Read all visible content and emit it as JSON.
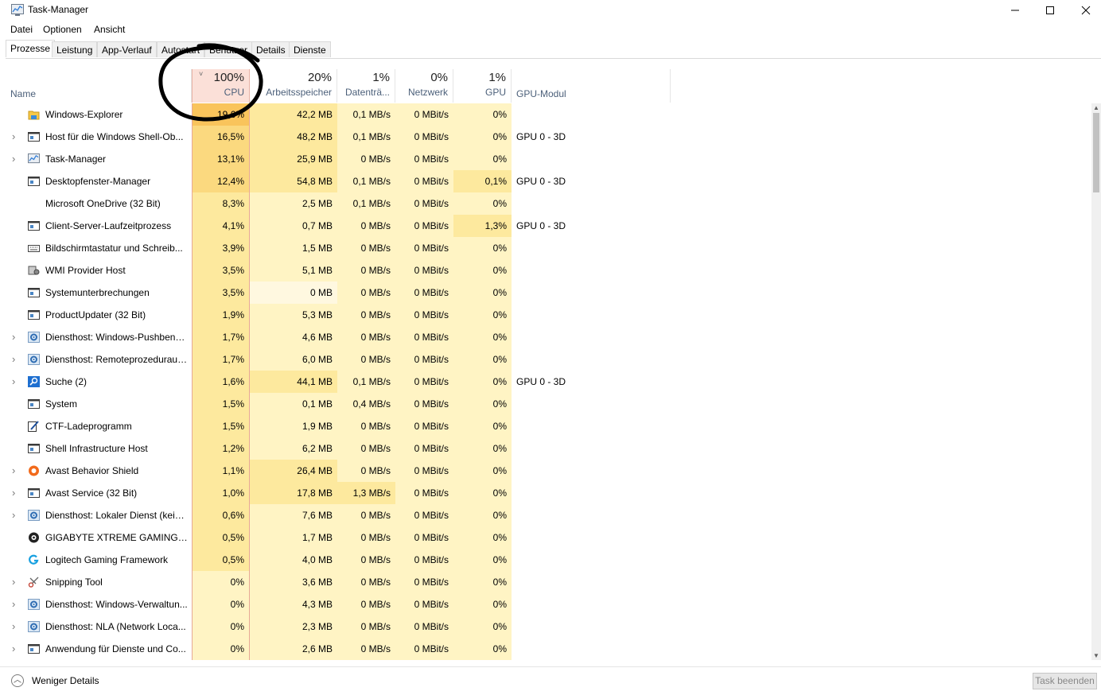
{
  "window": {
    "title": "Task-Manager",
    "icon": "task-manager-icon"
  },
  "window_controls": {
    "minimize": "—",
    "maximize": "☐",
    "close": "✕"
  },
  "menu": [
    "Datei",
    "Optionen",
    "Ansicht"
  ],
  "tabs": [
    "Prozesse",
    "Leistung",
    "App-Verlauf",
    "Autostart",
    "Benutzer",
    "Details",
    "Dienste"
  ],
  "active_tab": "Prozesse",
  "columns": {
    "name": "Name",
    "cpu": {
      "pct": "100%",
      "label": "CPU"
    },
    "memory": {
      "pct": "20%",
      "label": "Arbeitsspeicher"
    },
    "disk": {
      "pct": "1%",
      "label": "Datenträ..."
    },
    "network": {
      "pct": "0%",
      "label": "Netzwerk"
    },
    "gpu": {
      "pct": "1%",
      "label": "GPU"
    },
    "gpu_engine": {
      "label": "GPU-Modul"
    }
  },
  "sort_indicator": "˅",
  "processes": [
    {
      "name": "Windows-Explorer",
      "expand": false,
      "icon": "folder-icon",
      "cpu": "19,6%",
      "mem": "42,2 MB",
      "disk": "0,1 MB/s",
      "net": "0 MBit/s",
      "gpu": "0%",
      "engine": "",
      "cpu_level": 4,
      "mem_level": 2,
      "disk_level": 1,
      "gpu_level": 1
    },
    {
      "name": "Host für die Windows Shell-Ob...",
      "expand": true,
      "icon": "window-app-icon",
      "cpu": "16,5%",
      "mem": "48,2 MB",
      "disk": "0,1 MB/s",
      "net": "0 MBit/s",
      "gpu": "0%",
      "engine": "GPU 0 - 3D",
      "cpu_level": 3,
      "mem_level": 2,
      "disk_level": 1,
      "gpu_level": 1
    },
    {
      "name": "Task-Manager",
      "expand": true,
      "icon": "task-manager-icon",
      "cpu": "13,1%",
      "mem": "25,9 MB",
      "disk": "0 MB/s",
      "net": "0 MBit/s",
      "gpu": "0%",
      "engine": "",
      "cpu_level": 3,
      "mem_level": 2,
      "disk_level": 1,
      "gpu_level": 1
    },
    {
      "name": "Desktopfenster-Manager",
      "expand": false,
      "icon": "window-app-icon",
      "cpu": "12,4%",
      "mem": "54,8 MB",
      "disk": "0,1 MB/s",
      "net": "0 MBit/s",
      "gpu": "0,1%",
      "engine": "GPU 0 - 3D",
      "cpu_level": 3,
      "mem_level": 2,
      "disk_level": 1,
      "gpu_level": 2
    },
    {
      "name": "Microsoft OneDrive (32 Bit)",
      "expand": false,
      "icon": "blank-icon",
      "cpu": "8,3%",
      "mem": "2,5 MB",
      "disk": "0,1 MB/s",
      "net": "0 MBit/s",
      "gpu": "0%",
      "engine": "",
      "cpu_level": 2,
      "mem_level": 1,
      "disk_level": 1,
      "gpu_level": 1
    },
    {
      "name": "Client-Server-Laufzeitprozess",
      "expand": false,
      "icon": "window-app-icon",
      "cpu": "4,1%",
      "mem": "0,7 MB",
      "disk": "0 MB/s",
      "net": "0 MBit/s",
      "gpu": "1,3%",
      "engine": "GPU 0 - 3D",
      "cpu_level": 2,
      "mem_level": 1,
      "disk_level": 1,
      "gpu_level": 2
    },
    {
      "name": "Bildschirmtastatur und Schreib...",
      "expand": false,
      "icon": "keyboard-icon",
      "cpu": "3,9%",
      "mem": "1,5 MB",
      "disk": "0 MB/s",
      "net": "0 MBit/s",
      "gpu": "0%",
      "engine": "",
      "cpu_level": 2,
      "mem_level": 1,
      "disk_level": 1,
      "gpu_level": 1
    },
    {
      "name": "WMI Provider Host",
      "expand": false,
      "icon": "wmi-icon",
      "cpu": "3,5%",
      "mem": "5,1 MB",
      "disk": "0 MB/s",
      "net": "0 MBit/s",
      "gpu": "0%",
      "engine": "",
      "cpu_level": 2,
      "mem_level": 1,
      "disk_level": 1,
      "gpu_level": 1
    },
    {
      "name": "Systemunterbrechungen",
      "expand": false,
      "icon": "window-app-icon",
      "cpu": "3,5%",
      "mem": "0 MB",
      "disk": "0 MB/s",
      "net": "0 MBit/s",
      "gpu": "0%",
      "engine": "",
      "cpu_level": 2,
      "mem_level": 0,
      "disk_level": 1,
      "gpu_level": 1
    },
    {
      "name": "ProductUpdater (32 Bit)",
      "expand": false,
      "icon": "window-app-icon",
      "cpu": "1,9%",
      "mem": "5,3 MB",
      "disk": "0 MB/s",
      "net": "0 MBit/s",
      "gpu": "0%",
      "engine": "",
      "cpu_level": 2,
      "mem_level": 1,
      "disk_level": 1,
      "gpu_level": 1
    },
    {
      "name": "Diensthost: Windows-Pushbena...",
      "expand": true,
      "icon": "gear-icon",
      "cpu": "1,7%",
      "mem": "4,6 MB",
      "disk": "0 MB/s",
      "net": "0 MBit/s",
      "gpu": "0%",
      "engine": "",
      "cpu_level": 2,
      "mem_level": 1,
      "disk_level": 1,
      "gpu_level": 1
    },
    {
      "name": "Diensthost: Remoteprozeduraufr...",
      "expand": true,
      "icon": "gear-icon",
      "cpu": "1,7%",
      "mem": "6,0 MB",
      "disk": "0 MB/s",
      "net": "0 MBit/s",
      "gpu": "0%",
      "engine": "",
      "cpu_level": 2,
      "mem_level": 1,
      "disk_level": 1,
      "gpu_level": 1
    },
    {
      "name": "Suche (2)",
      "expand": true,
      "icon": "search-icon",
      "cpu": "1,6%",
      "mem": "44,1 MB",
      "disk": "0,1 MB/s",
      "net": "0 MBit/s",
      "gpu": "0%",
      "engine": "GPU 0 - 3D",
      "cpu_level": 2,
      "mem_level": 2,
      "disk_level": 1,
      "gpu_level": 1
    },
    {
      "name": "System",
      "expand": false,
      "icon": "window-app-icon",
      "cpu": "1,5%",
      "mem": "0,1 MB",
      "disk": "0,4 MB/s",
      "net": "0 MBit/s",
      "gpu": "0%",
      "engine": "",
      "cpu_level": 2,
      "mem_level": 1,
      "disk_level": 1,
      "gpu_level": 1
    },
    {
      "name": "CTF-Ladeprogramm",
      "expand": false,
      "icon": "pen-icon",
      "cpu": "1,5%",
      "mem": "1,9 MB",
      "disk": "0 MB/s",
      "net": "0 MBit/s",
      "gpu": "0%",
      "engine": "",
      "cpu_level": 2,
      "mem_level": 1,
      "disk_level": 1,
      "gpu_level": 1
    },
    {
      "name": "Shell Infrastructure Host",
      "expand": false,
      "icon": "window-app-icon",
      "cpu": "1,2%",
      "mem": "6,2 MB",
      "disk": "0 MB/s",
      "net": "0 MBit/s",
      "gpu": "0%",
      "engine": "",
      "cpu_level": 2,
      "mem_level": 1,
      "disk_level": 1,
      "gpu_level": 1
    },
    {
      "name": "Avast Behavior Shield",
      "expand": true,
      "icon": "avast-icon",
      "cpu": "1,1%",
      "mem": "26,4 MB",
      "disk": "0 MB/s",
      "net": "0 MBit/s",
      "gpu": "0%",
      "engine": "",
      "cpu_level": 2,
      "mem_level": 2,
      "disk_level": 1,
      "gpu_level": 1
    },
    {
      "name": "Avast Service (32 Bit)",
      "expand": true,
      "icon": "window-app-icon",
      "cpu": "1,0%",
      "mem": "17,8 MB",
      "disk": "1,3 MB/s",
      "net": "0 MBit/s",
      "gpu": "0%",
      "engine": "",
      "cpu_level": 2,
      "mem_level": 2,
      "disk_level": 2,
      "gpu_level": 1
    },
    {
      "name": "Diensthost: Lokaler Dienst (kein ...",
      "expand": true,
      "icon": "gear-icon",
      "cpu": "0,6%",
      "mem": "7,6 MB",
      "disk": "0 MB/s",
      "net": "0 MBit/s",
      "gpu": "0%",
      "engine": "",
      "cpu_level": 2,
      "mem_level": 1,
      "disk_level": 1,
      "gpu_level": 1
    },
    {
      "name": "GIGABYTE XTREME GAMING E...",
      "expand": false,
      "icon": "gigabyte-icon",
      "cpu": "0,5%",
      "mem": "1,7 MB",
      "disk": "0 MB/s",
      "net": "0 MBit/s",
      "gpu": "0%",
      "engine": "",
      "cpu_level": 2,
      "mem_level": 1,
      "disk_level": 1,
      "gpu_level": 1
    },
    {
      "name": "Logitech Gaming Framework",
      "expand": false,
      "icon": "logitech-icon",
      "cpu": "0,5%",
      "mem": "4,0 MB",
      "disk": "0 MB/s",
      "net": "0 MBit/s",
      "gpu": "0%",
      "engine": "",
      "cpu_level": 2,
      "mem_level": 1,
      "disk_level": 1,
      "gpu_level": 1
    },
    {
      "name": "Snipping Tool",
      "expand": true,
      "icon": "scissors-icon",
      "cpu": "0%",
      "mem": "3,6 MB",
      "disk": "0 MB/s",
      "net": "0 MBit/s",
      "gpu": "0%",
      "engine": "",
      "cpu_level": 1,
      "mem_level": 1,
      "disk_level": 1,
      "gpu_level": 1
    },
    {
      "name": "Diensthost: Windows-Verwaltun...",
      "expand": true,
      "icon": "gear-icon",
      "cpu": "0%",
      "mem": "4,3 MB",
      "disk": "0 MB/s",
      "net": "0 MBit/s",
      "gpu": "0%",
      "engine": "",
      "cpu_level": 1,
      "mem_level": 1,
      "disk_level": 1,
      "gpu_level": 1
    },
    {
      "name": "Diensthost: NLA (Network Loca...",
      "expand": true,
      "icon": "gear-icon",
      "cpu": "0%",
      "mem": "2,3 MB",
      "disk": "0 MB/s",
      "net": "0 MBit/s",
      "gpu": "0%",
      "engine": "",
      "cpu_level": 1,
      "mem_level": 1,
      "disk_level": 1,
      "gpu_level": 1
    },
    {
      "name": "Anwendung für Dienste und Co...",
      "expand": true,
      "icon": "window-app-icon",
      "cpu": "0%",
      "mem": "2,6 MB",
      "disk": "0 MB/s",
      "net": "0 MBit/s",
      "gpu": "0%",
      "engine": "",
      "cpu_level": 1,
      "mem_level": 1,
      "disk_level": 1,
      "gpu_level": 1
    }
  ],
  "footer": {
    "fewer_details": "Weniger Details",
    "end_task": "Task beenden"
  },
  "colors": {
    "heat": [
      "#fff8e0",
      "#fff4c4",
      "#fde99e",
      "#fbd97f",
      "#f9c45c"
    ],
    "cpu_header": "#fbe0d8",
    "cpu_border": "#e7a896",
    "annotation": "#000000"
  }
}
